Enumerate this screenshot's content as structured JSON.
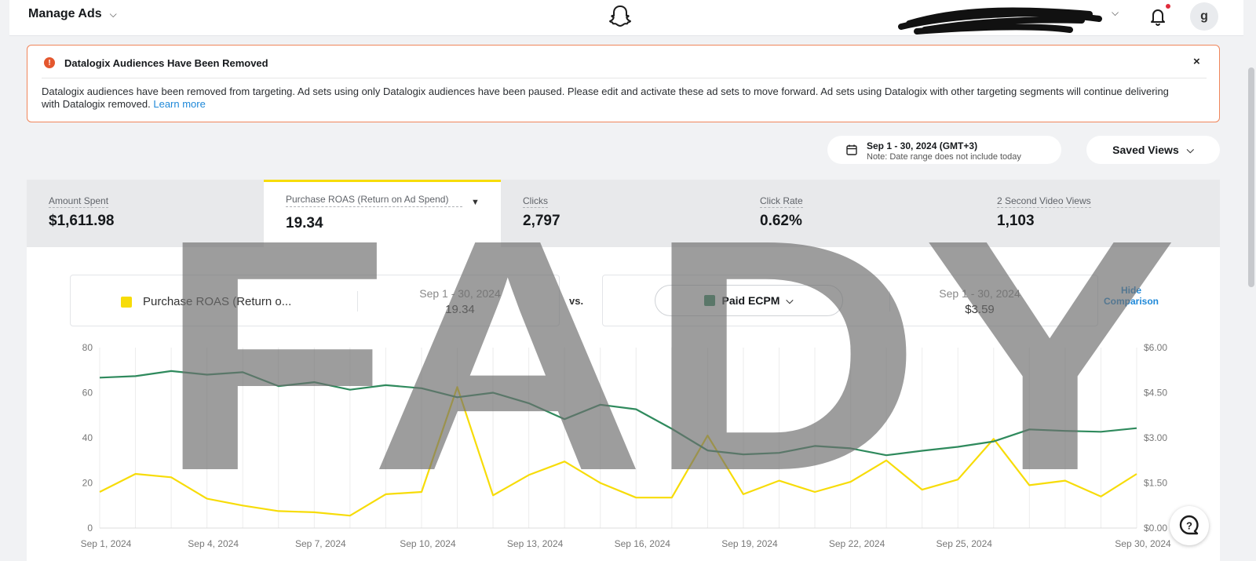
{
  "header": {
    "title": "Manage Ads",
    "avatar_initial": "g"
  },
  "alert": {
    "icon_glyph": "!",
    "title": "Datalogix Audiences Have Been Removed",
    "close_glyph": "×",
    "body": "Datalogix audiences have been removed from targeting. Ad sets using only Datalogix audiences have been paused. Please edit and activate these ad sets to move forward. Ad sets using Datalogix with other targeting segments will continue delivering with Datalogix removed.",
    "link": "Learn more"
  },
  "date_picker": {
    "range": "Sep 1 - 30, 2024 (GMT+3)",
    "note": "Note: Date range does not include today"
  },
  "saved_views": {
    "label": "Saved Views"
  },
  "metrics": [
    {
      "label": "Amount Spent",
      "value": "$1,611.98"
    },
    {
      "label": "Purchase ROAS (Return on Ad Spend)",
      "value": "19.34"
    },
    {
      "label": "Clicks",
      "value": "2,797"
    },
    {
      "label": "Click Rate",
      "value": "0.62%"
    },
    {
      "label": "2 Second Video Views",
      "value": "1,103"
    }
  ],
  "comparison": {
    "primary": {
      "label": "Purchase ROAS (Return o...",
      "range": "Sep 1 - 30, 2024",
      "value": "19.34",
      "color": "#f7dc08"
    },
    "vs": "vs.",
    "secondary": {
      "label": "Paid ECPM",
      "range": "Sep 1 - 30, 2024",
      "value": "$3.59",
      "color": "#2f8a5d"
    },
    "hide_line1": "Hide",
    "hide_line2": "Comparison"
  },
  "watermark": {
    "text": "FADY"
  },
  "chart_data": {
    "type": "line",
    "x": [
      "Sep 1",
      "Sep 2",
      "Sep 3",
      "Sep 4",
      "Sep 5",
      "Sep 6",
      "Sep 7",
      "Sep 8",
      "Sep 9",
      "Sep 10",
      "Sep 11",
      "Sep 12",
      "Sep 13",
      "Sep 14",
      "Sep 15",
      "Sep 16",
      "Sep 17",
      "Sep 18",
      "Sep 19",
      "Sep 20",
      "Sep 21",
      "Sep 22",
      "Sep 23",
      "Sep 24",
      "Sep 25",
      "Sep 26",
      "Sep 27",
      "Sep 28",
      "Sep 29",
      "Sep 30"
    ],
    "x_ticks": [
      "Sep 1, 2024",
      "Sep 4, 2024",
      "Sep 7, 2024",
      "Sep 10, 2024",
      "Sep 13, 2024",
      "Sep 16, 2024",
      "Sep 19, 2024",
      "Sep 22, 2024",
      "Sep 25, 2024",
      "Sep 30, 2024"
    ],
    "x_tick_index": [
      0,
      3,
      6,
      9,
      12,
      15,
      18,
      21,
      24,
      29
    ],
    "series": [
      {
        "name": "Purchase ROAS (Return o...",
        "axis": "left",
        "color": "#f7dc08",
        "values": [
          16,
          24,
          22.5,
          13,
          10,
          7.5,
          7,
          5.5,
          15,
          16,
          62.5,
          14.5,
          23.5,
          29.5,
          20,
          13.5,
          13.5,
          41,
          15,
          21,
          16,
          20.5,
          30,
          17,
          21.5,
          39.5,
          19,
          21,
          14,
          24
        ]
      },
      {
        "name": "Paid ECPM",
        "axis": "right",
        "color": "#2f8a5d",
        "values": [
          5.0,
          5.05,
          5.22,
          5.1,
          5.18,
          4.72,
          4.85,
          4.6,
          4.75,
          4.65,
          4.35,
          4.5,
          4.15,
          3.62,
          4.1,
          3.95,
          3.3,
          2.58,
          2.45,
          2.5,
          2.73,
          2.65,
          2.42,
          2.57,
          2.7,
          2.88,
          3.28,
          3.23,
          3.2,
          3.32
        ]
      }
    ],
    "y_left": {
      "ticks": [
        "0",
        "20",
        "40",
        "60",
        "80"
      ],
      "ylim": [
        0,
        80
      ]
    },
    "y_right": {
      "ticks": [
        "$0.00",
        "$1.50",
        "$3.00",
        "$4.50",
        "$6.00"
      ],
      "ylim": [
        0,
        6
      ]
    },
    "grid": "vertical"
  }
}
